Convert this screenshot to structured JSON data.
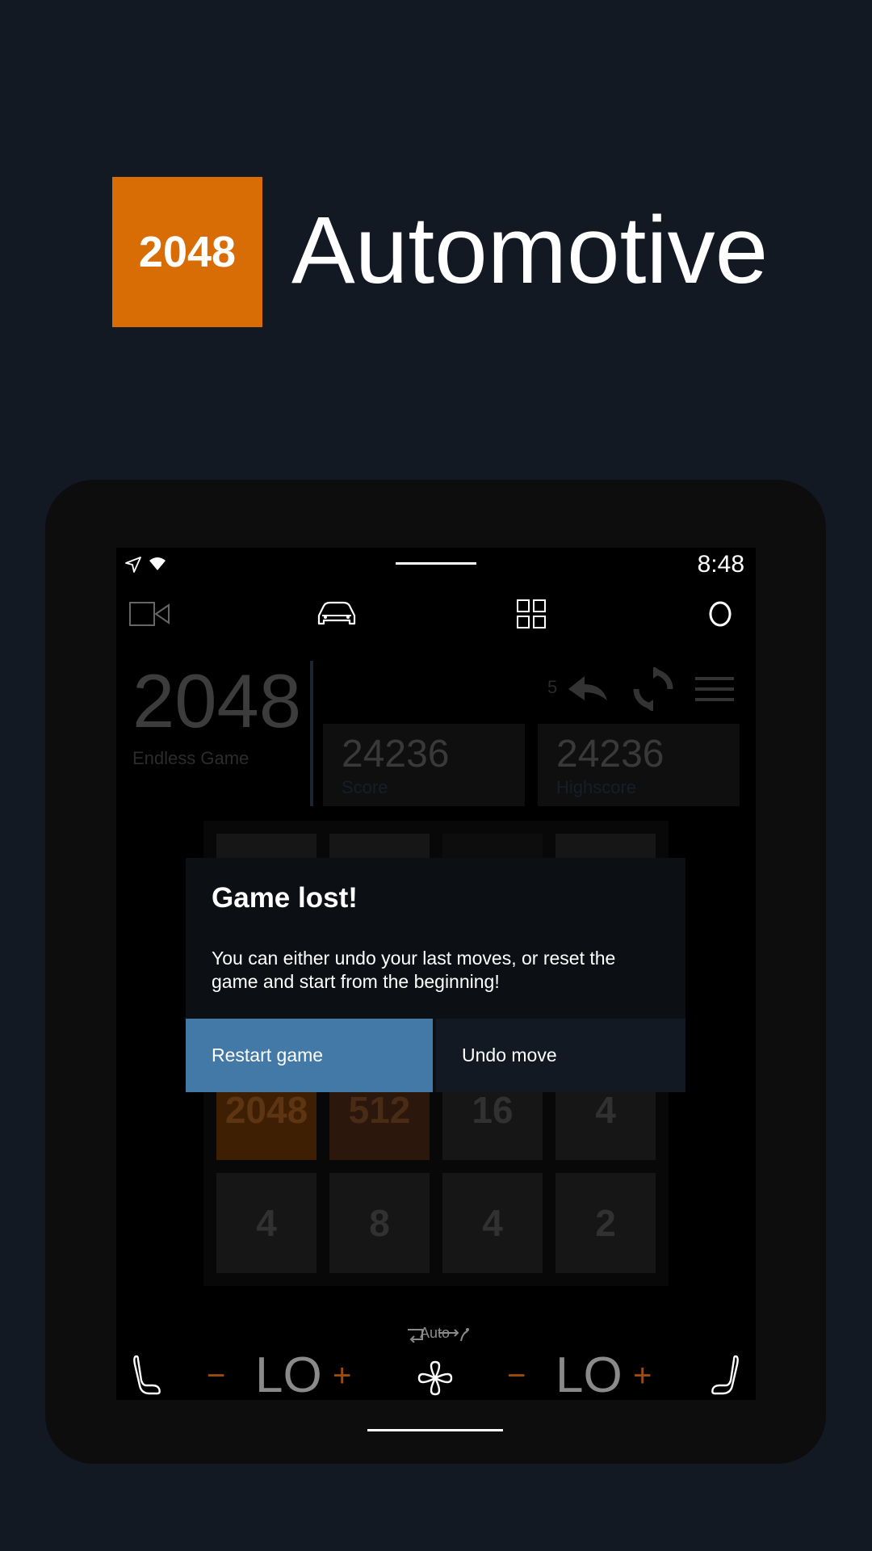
{
  "header": {
    "logo_text": "2048",
    "title": "Automotive"
  },
  "status_bar": {
    "time": "8:48"
  },
  "game": {
    "logo": "2048",
    "mode": "Endless Game",
    "undo_count": "5",
    "score": {
      "value": "24236",
      "label": "Score"
    },
    "highscore": {
      "value": "24236",
      "label": "Highscore"
    },
    "tiles": [
      [
        "",
        "",
        "",
        ""
      ],
      [
        "",
        "",
        "",
        ""
      ],
      [
        "2048",
        "512",
        "16",
        "4"
      ],
      [
        "4",
        "8",
        "4",
        "2"
      ]
    ]
  },
  "dialog": {
    "title": "Game lost!",
    "message": "You can either undo your last moves, or reset the game and start from the beginning!",
    "primary_button": "Restart game",
    "secondary_button": "Undo move"
  },
  "climate": {
    "left_temp": "LO",
    "right_temp": "LO",
    "minus": "−",
    "plus": "+",
    "fan_mode": "Auto"
  },
  "colors": {
    "background": "#121923",
    "logo_orange": "#d86c05",
    "primary_button": "#4379a6",
    "secondary_button": "#121923",
    "dialog_bg": "#0c1015"
  },
  "icons": [
    "navigation-icon",
    "wifi-icon",
    "camera-icon",
    "car-icon",
    "apps-grid-icon",
    "circle-icon",
    "undo-icon",
    "refresh-icon",
    "menu-icon",
    "seat-left-icon",
    "fan-icon",
    "seat-right-icon",
    "recirculation-icon",
    "airflow-icon"
  ]
}
